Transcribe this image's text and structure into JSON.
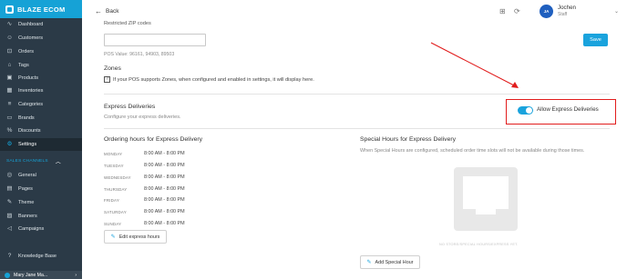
{
  "brand": {
    "name": "BLAZE ECOM"
  },
  "sidebar": {
    "items": [
      {
        "label": "Dashboard",
        "icon": "pulse-icon"
      },
      {
        "label": "Customers",
        "icon": "users-icon"
      },
      {
        "label": "Orders",
        "icon": "cart-icon"
      },
      {
        "label": "Tags",
        "icon": "tag-icon"
      },
      {
        "label": "Products",
        "icon": "box-icon"
      },
      {
        "label": "Inventories",
        "icon": "grid-icon"
      },
      {
        "label": "Categories",
        "icon": "layers-icon"
      },
      {
        "label": "Brands",
        "icon": "briefcase-icon"
      },
      {
        "label": "Discounts",
        "icon": "discount-icon"
      },
      {
        "label": "Settings",
        "icon": "gear-icon"
      }
    ],
    "section_label": "SALES CHANNELS",
    "channel_items": [
      {
        "label": "General",
        "icon": "globe-icon"
      },
      {
        "label": "Pages",
        "icon": "file-icon"
      },
      {
        "label": "Theme",
        "icon": "brush-icon"
      },
      {
        "label": "Banners",
        "icon": "image-icon"
      },
      {
        "label": "Campaigns",
        "icon": "megaphone-icon"
      }
    ],
    "kb_label": "Knowledge Base",
    "user_name": "Mary Jane Ma..."
  },
  "header": {
    "back_label": "Back",
    "user_initials": "JA",
    "user_name": "Jochen",
    "user_role": "Staff"
  },
  "zip": {
    "label": "Restricted ZIP codes",
    "value": "",
    "pos_value": "POS Value: 96161, 94903, 89503",
    "save_label": "Save"
  },
  "zones": {
    "title": "Zones",
    "help_icon": "?",
    "description": "If your POS supports Zones, when configured and enabled in settings, it will display here."
  },
  "express": {
    "title": "Express Deliveries",
    "subtitle": "Configure your express deliveries.",
    "toggle_label": "Allow Express Deliveries",
    "toggle_on": true,
    "highlight_color": "#e11c1c"
  },
  "ordering_hours": {
    "title": "Ordering hours for Express Delivery",
    "rows": [
      {
        "day": "MONDAY",
        "time": "8:00 AM - 8:00 PM"
      },
      {
        "day": "TUESDAY",
        "time": "8:00 AM - 8:00 PM"
      },
      {
        "day": "WEDNESDAY",
        "time": "8:00 AM - 8:00 PM"
      },
      {
        "day": "THURSDAY",
        "time": "8:00 AM - 8:00 PM"
      },
      {
        "day": "FRIDAY",
        "time": "8:00 AM - 8:00 PM"
      },
      {
        "day": "SATURDAY",
        "time": "8:00 AM - 8:00 PM"
      },
      {
        "day": "SUNDAY",
        "time": "8:00 AM - 8:00 PM"
      }
    ],
    "edit_label": "Edit express hours"
  },
  "special_hours": {
    "title": "Special Hours for Express Delivery",
    "description": "When Special Hours are configured, scheduled order time slots will not be available during those times.",
    "empty_text": "NO STORE/SPECIAL HOURS/EXPRESS YET.",
    "add_label": "Add Special Hour"
  }
}
